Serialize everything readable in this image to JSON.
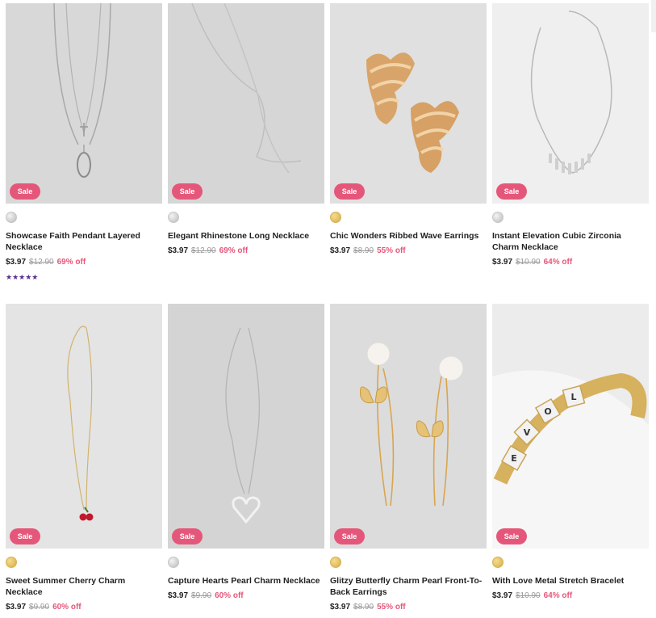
{
  "products": [
    {
      "name": "Showcase Faith Pendant Layered Necklace",
      "price": "$3.97",
      "original_price": "$12.90",
      "discount": "69% off",
      "badge": "Sale",
      "swatch": "silver",
      "rating": "★★★★★",
      "image_icon": "layered-necklace-icon"
    },
    {
      "name": "Elegant Rhinestone Long Necklace",
      "price": "$3.97",
      "original_price": "$12.90",
      "discount": "69% off",
      "badge": "Sale",
      "swatch": "silver",
      "image_icon": "long-necklace-icon"
    },
    {
      "name": "Chic Wonders Ribbed Wave Earrings",
      "price": "$3.97",
      "original_price": "$8.90",
      "discount": "55% off",
      "badge": "Sale",
      "swatch": "gold",
      "image_icon": "wave-earrings-icon"
    },
    {
      "name": "Instant Elevation Cubic Zirconia Charm Necklace",
      "price": "$3.97",
      "original_price": "$10.90",
      "discount": "64% off",
      "badge": "Sale",
      "swatch": "silver",
      "image_icon": "charm-necklace-icon"
    },
    {
      "name": "Sweet Summer Cherry Charm Necklace",
      "price": "$3.97",
      "original_price": "$9.90",
      "discount": "60% off",
      "badge": "Sale",
      "swatch": "gold",
      "image_icon": "cherry-necklace-icon"
    },
    {
      "name": "Capture Hearts Pearl Charm Necklace",
      "price": "$3.97",
      "original_price": "$9.90",
      "discount": "60% off",
      "badge": "Sale",
      "swatch": "silver",
      "image_icon": "heart-necklace-icon"
    },
    {
      "name": "Glitzy Butterfly Charm Pearl Front-To-Back Earrings",
      "price": "$3.97",
      "original_price": "$8.90",
      "discount": "55% off",
      "badge": "Sale",
      "swatch": "gold",
      "image_icon": "butterfly-earrings-icon"
    },
    {
      "name": "With Love Metal Stretch Bracelet",
      "price": "$3.97",
      "original_price": "$10.90",
      "discount": "64% off",
      "badge": "Sale",
      "swatch": "gold",
      "image_icon": "love-bracelet-icon"
    }
  ],
  "colors": {
    "sale_badge": "#e5577a",
    "discount_text": "#e5577a",
    "rating_stars": "#5a2d8c",
    "image_bg": "#dcdcdc"
  },
  "bracelet_letters": [
    "L",
    "O",
    "V",
    "E"
  ]
}
